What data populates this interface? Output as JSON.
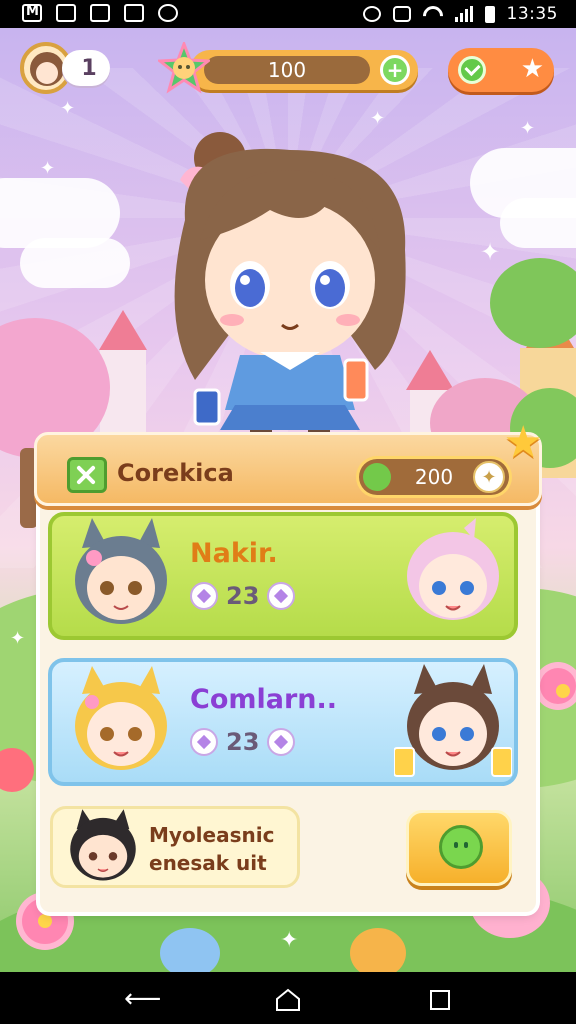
{
  "status_bar": {
    "time": "13:35",
    "icons": [
      "gmail-icon",
      "gallery-icon",
      "chat-icon",
      "clipboard-icon",
      "circle-app-icon",
      "alarm-icon",
      "vibrate-icon",
      "wifi-icon",
      "signal-icon",
      "battery-icon"
    ]
  },
  "hud": {
    "level": "1",
    "coins": "100",
    "coins_plus_icon": "plus-icon",
    "reward_icons": [
      "check-icon",
      "star-icon"
    ]
  },
  "panel": {
    "title": "Corekica",
    "currency": "200",
    "cards": [
      {
        "name": "Nakir.",
        "stat": "23",
        "color": "#b5dc4a"
      },
      {
        "name": "Comlarn..",
        "stat": "23",
        "color": "#a9dcf7"
      }
    ],
    "bottom_card": {
      "line1": "Myoleasnic",
      "line2": "enesak uit"
    }
  },
  "nav": {
    "icons": [
      "back-icon",
      "home-icon",
      "recents-icon"
    ]
  }
}
